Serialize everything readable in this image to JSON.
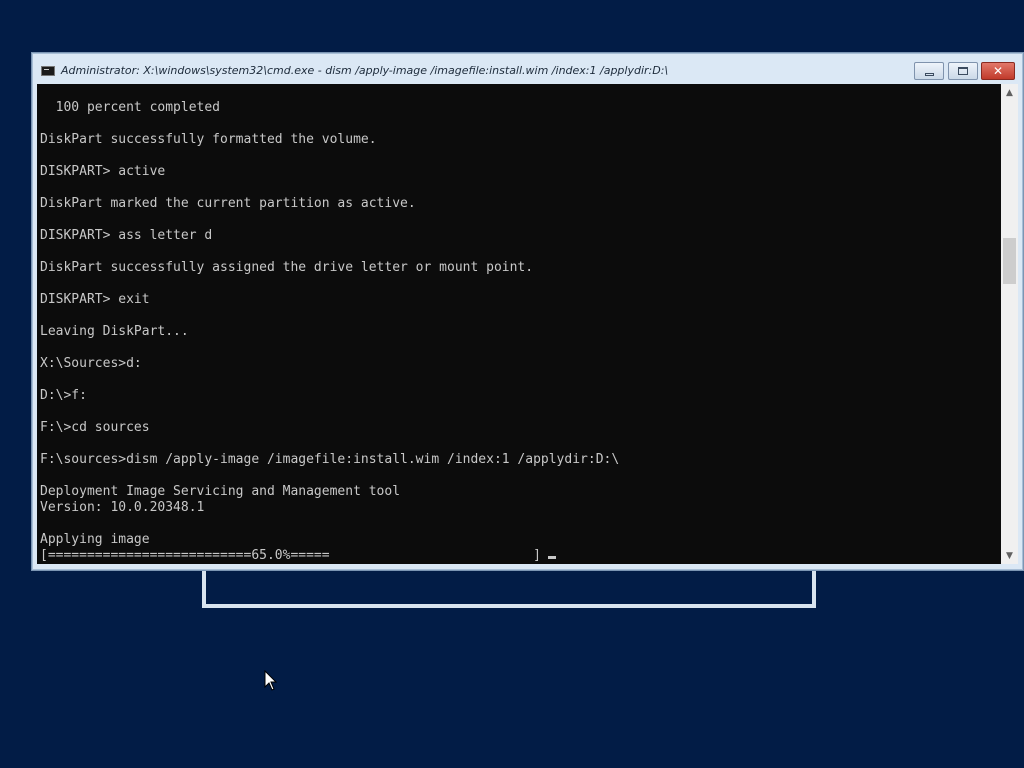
{
  "window": {
    "title": "Administrator: X:\\windows\\system32\\cmd.exe - dism  /apply-image /imagefile:install.wim /index:1 /applydir:D:\\",
    "icon": "cmd-icon",
    "buttons": {
      "minimize": "minimize-icon",
      "maximize": "maximize-icon",
      "close": "close-icon",
      "close_glyph": "✕"
    }
  },
  "console": {
    "lines": [
      "  100 percent completed",
      "",
      "DiskPart successfully formatted the volume.",
      "",
      "DISKPART> active",
      "",
      "DiskPart marked the current partition as active.",
      "",
      "DISKPART> ass letter d",
      "",
      "DiskPart successfully assigned the drive letter or mount point.",
      "",
      "DISKPART> exit",
      "",
      "Leaving DiskPart...",
      "",
      "X:\\Sources>d:",
      "",
      "D:\\>f:",
      "",
      "F:\\>cd sources",
      "",
      "F:\\sources>dism /apply-image /imagefile:install.wim /index:1 /applydir:D:\\",
      "",
      "Deployment Image Servicing and Management tool",
      "Version: 10.0.20348.1",
      "",
      "Applying image"
    ],
    "progress_line": "[==========================65.0%=====                          ]",
    "progress_percent": 65.0
  },
  "scrollbar": {
    "up_arrow": "▲",
    "down_arrow": "▼"
  },
  "colors": {
    "desktop": "#021c46",
    "console_bg": "#0c0c0c",
    "console_text": "#c8c8c8",
    "window_frame": "#dbe8f5",
    "close_button": "#c94a3b"
  }
}
